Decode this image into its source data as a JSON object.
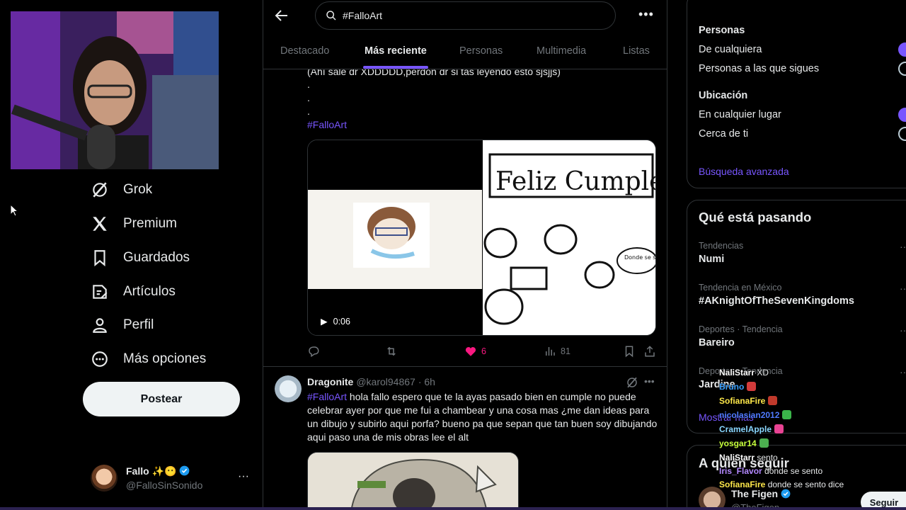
{
  "nav": {
    "items": [
      {
        "label": "Grok",
        "icon": "grok-icon"
      },
      {
        "label": "Premium",
        "icon": "x-logo-icon"
      },
      {
        "label": "Guardados",
        "icon": "bookmark-icon"
      },
      {
        "label": "Artículos",
        "icon": "article-icon"
      },
      {
        "label": "Perfil",
        "icon": "person-icon"
      },
      {
        "label": "Más opciones",
        "icon": "more-circle-icon"
      }
    ],
    "post_button": "Postear",
    "account": {
      "name": "Fallo ✨😶",
      "handle": "@FalloSinSonido",
      "more": "···"
    }
  },
  "search": {
    "value": "#FalloArt"
  },
  "tabs": [
    "Destacado",
    "Más reciente",
    "Personas",
    "Multimedia",
    "Listas"
  ],
  "post1": {
    "text_line": "(Ahí sale dr XDDDDD,perdon dr si tas leyendo esto sjsjjs)",
    "dots": [
      ".",
      ".",
      "."
    ],
    "hashtag": "#FalloArt",
    "video_time": "0:06",
    "image_text": "Feliz Cumpleaños",
    "image_bubble": "Donde se sento?",
    "actions": {
      "likes": "6",
      "views": "81"
    }
  },
  "post2": {
    "name": "Dragonite",
    "handle": "@karol94867",
    "time": "· 6h",
    "hashtag": "#FalloArt",
    "text": " hola fallo espero que te la ayas pasado bien en cumple no puede celebrar ayer por que me fui a chambear y una cosa mas ¿me dan ideas para un dibujo y subirlo aqui porfa? bueno pa que sepan que tan buen soy dibujando aqui paso una de mis obras lee el alt"
  },
  "filters": {
    "people_title": "Personas",
    "people_opts": [
      "De cualquiera",
      "Personas a las que sigues"
    ],
    "location_title": "Ubicación",
    "location_opts": [
      "En cualquier lugar",
      "Cerca de ti"
    ],
    "advanced": "Búsqueda avanzada"
  },
  "trends": {
    "title": "Qué está pasando",
    "items": [
      {
        "meta": "Tendencias",
        "name": "Numi"
      },
      {
        "meta": "Tendencia en México",
        "name": "#AKnightOfTheSevenKingdoms"
      },
      {
        "meta": "Deportes · Tendencia",
        "name": "Bareiro"
      },
      {
        "meta": "Deportes · Tendencia",
        "name": "Jardine"
      }
    ],
    "show_more": "Mostrar más"
  },
  "who": {
    "title": "A quién seguir",
    "name": "The Figen",
    "handle": "@TheFigen",
    "follow": "Seguir"
  },
  "chat": [
    {
      "user": "NaliStarr",
      "msg": "XD",
      "color": "#ffffff"
    },
    {
      "user": "Bruno",
      "msg": "",
      "color": "#3aa0ff",
      "emote": "#d23b3b"
    },
    {
      "user": "SofianaFire",
      "msg": "",
      "color": "#ffe94a",
      "emote": "#c0392b"
    },
    {
      "user": "nicolasian2012",
      "msg": "",
      "color": "#4f7bff",
      "emote": "#3bb54a"
    },
    {
      "user": "CramelApple",
      "msg": "",
      "color": "#8ad7ff",
      "emote": "#e84393"
    },
    {
      "user": "yosgar14",
      "msg": "",
      "color": "#c7ff3c",
      "emote": "#4caf50"
    },
    {
      "user": "NaliStarr",
      "msg": "sento",
      "color": "#ffffff"
    },
    {
      "user": "Iris_Flavor",
      "msg": "donde se sento",
      "color": "#b388ff"
    },
    {
      "user": "SofianaFire",
      "msg": "donde se sento dice",
      "color": "#ffe94a"
    }
  ],
  "colors": {
    "accent": "#7856ff",
    "like": "#f91880",
    "border": "#2f3336",
    "muted": "#71767b"
  }
}
